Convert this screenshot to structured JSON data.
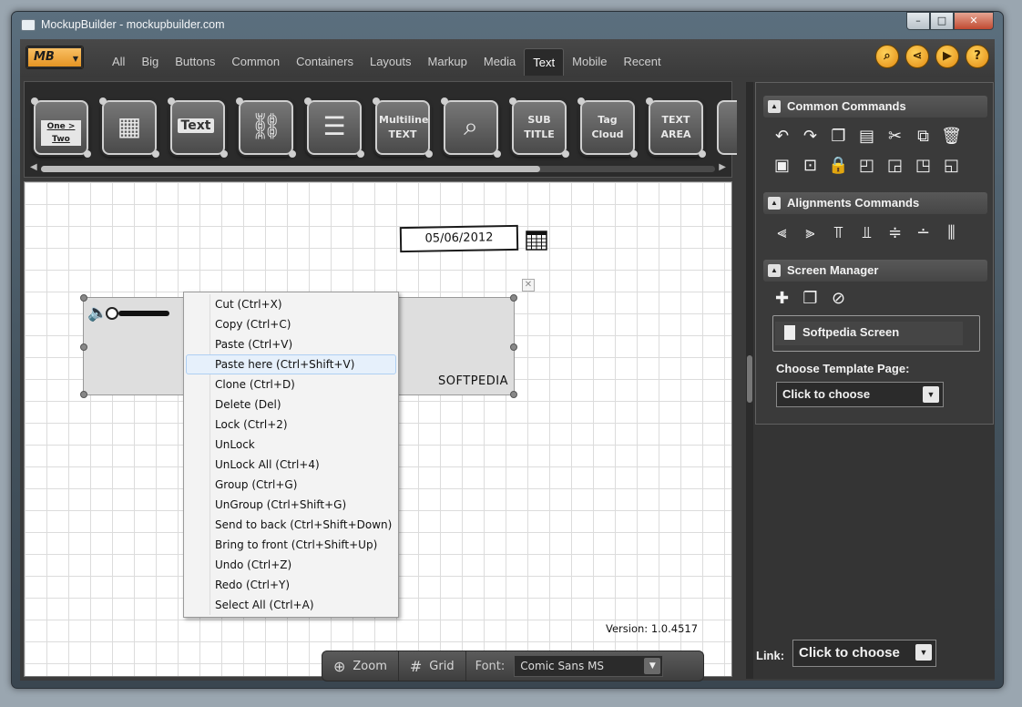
{
  "window": {
    "title": "MockupBuilder - mockupbuilder.com",
    "min": "–",
    "max": "□",
    "close": "✕"
  },
  "toolbar": {
    "logo": "MB",
    "tabs": [
      "All",
      "Big",
      "Buttons",
      "Common",
      "Containers",
      "Layouts",
      "Markup",
      "Media",
      "Text",
      "Mobile",
      "Recent"
    ],
    "active_tab": "Text"
  },
  "components": [
    {
      "name": "breadcrumb",
      "label": "One > Two"
    },
    {
      "name": "data-grid",
      "label": ""
    },
    {
      "name": "text",
      "label": "Text"
    },
    {
      "name": "link",
      "label": ""
    },
    {
      "name": "paragraph",
      "label": ""
    },
    {
      "name": "multiline-text",
      "label": "Multiline\nTEXT"
    },
    {
      "name": "search-box",
      "label": ""
    },
    {
      "name": "subtitle",
      "label": "SUB\nTITLE"
    },
    {
      "name": "tag-cloud",
      "label": "Tag\nCloud"
    },
    {
      "name": "text-area",
      "label": "TEXT\nAREA"
    }
  ],
  "canvas": {
    "date_value": "05/06/2012",
    "mockup_label": "SOFTPEDIA",
    "version": "Version: 1.0.4517"
  },
  "context_menu": [
    "Cut (Ctrl+X)",
    "Copy (Ctrl+C)",
    "Paste (Ctrl+V)",
    "Paste here (Ctrl+Shift+V)",
    "Clone (Ctrl+D)",
    "Delete (Del)",
    "Lock (Ctrl+2)",
    "UnLock",
    "UnLock All (Ctrl+4)",
    "Group (Ctrl+G)",
    "UnGroup (Ctrl+Shift+G)",
    "Send to back (Ctrl+Shift+Down)",
    "Bring to front (Ctrl+Shift+Up)",
    "Undo (Ctrl+Z)",
    "Redo (Ctrl+Y)",
    "Select All (Ctrl+A)"
  ],
  "context_menu_hovered": "Paste here (Ctrl+Shift+V)",
  "bottom_bar": {
    "zoom": "Zoom",
    "grid": "Grid",
    "font_label": "Font:",
    "font_value": "Comic Sans MS"
  },
  "right_panel": {
    "common_commands": "Common Commands",
    "alignments_commands": "Alignments Commands",
    "screen_manager": "Screen Manager",
    "screen_name": "Softpedia Screen",
    "template_label": "Choose Template Page:",
    "template_value": "Click to choose",
    "link_label": "Link:",
    "link_value": "Click to choose"
  },
  "colors": {
    "accent_orange": "#f0a020",
    "panel_dark": "#343434",
    "hover_blue": "#e6f0fb"
  }
}
